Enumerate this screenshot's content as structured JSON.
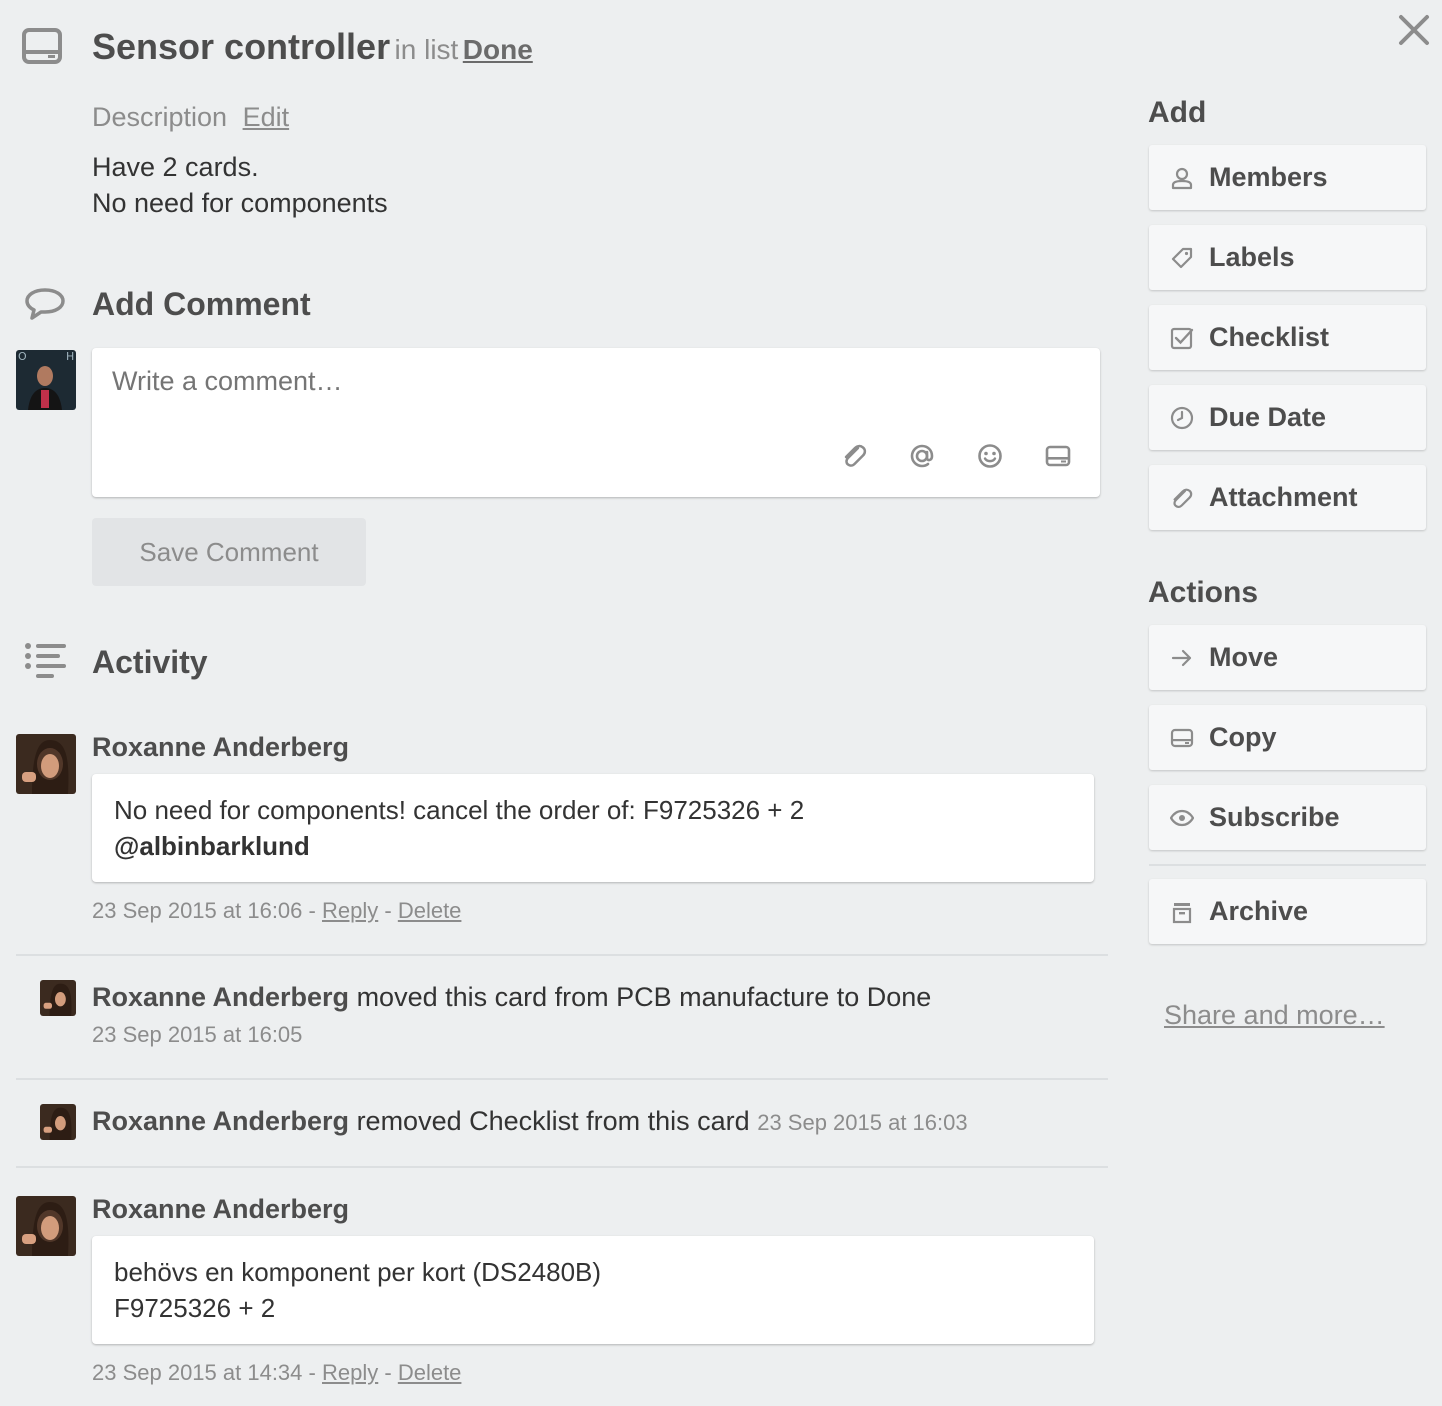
{
  "card": {
    "title": "Sensor controller",
    "in_list_prefix": "in list",
    "list_name": "Done"
  },
  "description": {
    "label": "Description",
    "edit_label": "Edit",
    "lines": [
      "Have 2 cards.",
      "No need for components"
    ]
  },
  "add_comment": {
    "title": "Add Comment",
    "placeholder": "Write a comment…",
    "save_label": "Save Comment"
  },
  "activity": {
    "title": "Activity",
    "items": [
      {
        "author": "Roxanne Anderberg",
        "comment_line1": "No need for components! cancel the order of: F9725326 + 2",
        "mention": "@albinbarklund",
        "timestamp": "23 Sep 2015 at 16:06",
        "reply": "Reply",
        "delete": "Delete",
        "sep": "-"
      },
      {
        "author": "Roxanne Anderberg",
        "action": "moved this card from PCB manufacture to Done",
        "timestamp": "23 Sep 2015 at 16:05"
      },
      {
        "author": "Roxanne Anderberg",
        "action": "removed Checklist from this card",
        "timestamp": "23 Sep 2015 at 16:03"
      },
      {
        "author": "Roxanne Anderberg",
        "comment_line1": "behövs en komponent per kort (DS2480B)",
        "comment_line2": "F9725326 + 2",
        "timestamp": "23 Sep 2015 at 14:34",
        "reply": "Reply",
        "delete": "Delete",
        "sep": "-"
      }
    ]
  },
  "sidebar": {
    "add_title": "Add",
    "add_buttons": [
      {
        "label": "Members",
        "icon": "person-icon"
      },
      {
        "label": "Labels",
        "icon": "tag-icon"
      },
      {
        "label": "Checklist",
        "icon": "checkbox-icon"
      },
      {
        "label": "Due Date",
        "icon": "clock-icon"
      },
      {
        "label": "Attachment",
        "icon": "paperclip-icon"
      }
    ],
    "actions_title": "Actions",
    "action_buttons": [
      {
        "label": "Move",
        "icon": "arrow-right-icon"
      },
      {
        "label": "Copy",
        "icon": "card-icon"
      },
      {
        "label": "Subscribe",
        "icon": "eye-icon"
      },
      {
        "label": "Archive",
        "icon": "archive-icon"
      }
    ],
    "share_label": "Share and more…"
  },
  "colors": {
    "background": "#edeff0",
    "text": "#4d4d4d",
    "muted": "#8c8c8c",
    "button": "#f6f7f8"
  }
}
